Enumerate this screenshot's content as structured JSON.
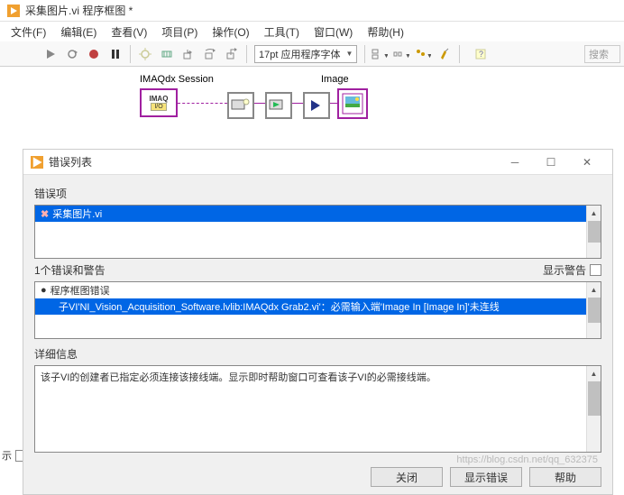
{
  "window": {
    "title": "采集图片.vi 程序框图 *"
  },
  "menu": {
    "file": "文件(F)",
    "edit": "编辑(E)",
    "view": "查看(V)",
    "project": "项目(P)",
    "operate": "操作(O)",
    "tools": "工具(T)",
    "window": "窗口(W)",
    "help": "帮助(H)"
  },
  "toolbar": {
    "font_label": "17pt 应用程序字体",
    "search_placeholder": "搜索"
  },
  "diagram": {
    "session_label": "IMAQdx Session",
    "image_label": "Image",
    "imaq_text": "IMAQ",
    "io_text": "I/O"
  },
  "error_dialog": {
    "title": "错误列表",
    "errors_label": "错误项",
    "error_item": "采集图片.vi",
    "count_label": "1个错误和警告",
    "show_warnings": "显示警告",
    "category_label": "程序框图错误",
    "error_detail": "子VI'NI_Vision_Acquisition_Software.lvlib:IMAQdx Grab2.vi'：必需输入端'Image In [Image In]'未连线",
    "details_label": "详细信息",
    "details_text": "该子VI的创建者已指定必须连接该接线端。显示即时帮助窗口可查看该子VI的必需接线端。",
    "close_btn": "关闭",
    "show_error_btn": "显示错误",
    "help_btn": "帮助"
  },
  "bottom": {
    "label": "示"
  },
  "watermark": "https://blog.csdn.net/qq_632375"
}
